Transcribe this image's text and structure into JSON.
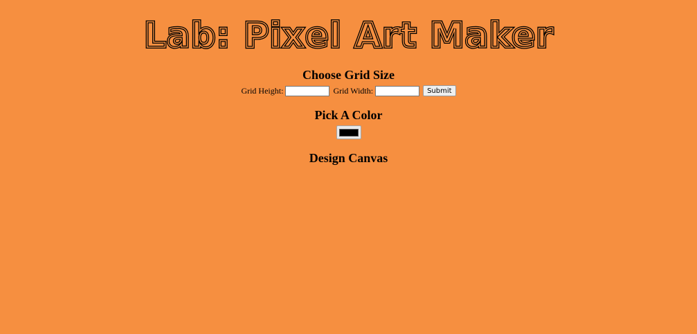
{
  "header": {
    "title": "Lab: Pixel Art Maker"
  },
  "grid_size": {
    "heading": "Choose Grid Size",
    "height_label": "Grid Height:",
    "height_value": "",
    "width_label": "Grid Width:",
    "width_value": "",
    "submit_label": "Submit"
  },
  "color": {
    "heading": "Pick A Color",
    "selected_value": "#000000"
  },
  "canvas": {
    "heading": "Design Canvas"
  },
  "theme": {
    "background": "#f68f40"
  }
}
